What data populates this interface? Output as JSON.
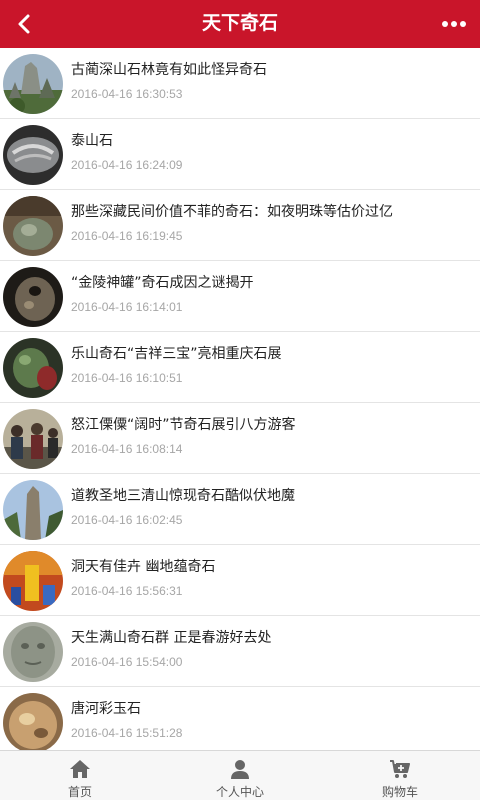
{
  "header": {
    "title": "天下奇石"
  },
  "articles": [
    {
      "title": "古蔺深山石林竟有如此怪异奇石",
      "date": "2016-04-16 16:30:53"
    },
    {
      "title": "泰山石",
      "date": "2016-04-16 16:24:09"
    },
    {
      "title": "那些深藏民间价值不菲的奇石：如夜明珠等估价过亿",
      "date": "2016-04-16 16:19:45"
    },
    {
      "title": "“金陵神罐”奇石成因之谜揭开",
      "date": "2016-04-16 16:14:01"
    },
    {
      "title": "乐山奇石“吉祥三宝”亮相重庆石展",
      "date": "2016-04-16 16:10:51"
    },
    {
      "title": "怒江傈僳“阔时”节奇石展引八方游客",
      "date": "2016-04-16 16:08:14"
    },
    {
      "title": "道教圣地三清山惊现奇石酷似伏地魔",
      "date": "2016-04-16 16:02:45"
    },
    {
      "title": "洞天有佳卉 幽地蕴奇石",
      "date": "2016-04-16 15:56:31"
    },
    {
      "title": "天生满山奇石群 正是春游好去处",
      "date": "2016-04-16 15:54:00"
    },
    {
      "title": "唐河彩玉石",
      "date": "2016-04-16 15:51:28"
    }
  ],
  "tabbar": {
    "home": "首页",
    "profile": "个人中心",
    "cart": "购物车"
  }
}
